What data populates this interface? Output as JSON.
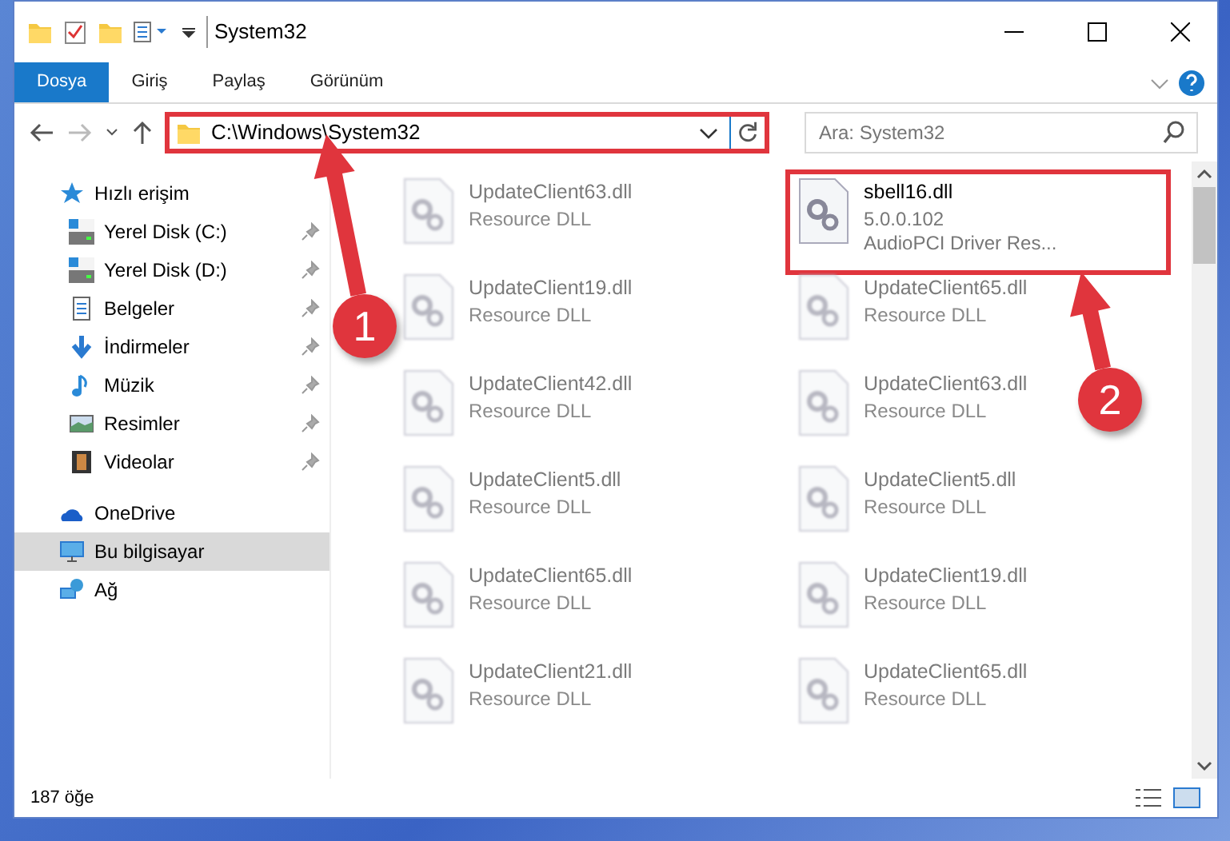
{
  "window": {
    "title": "System32"
  },
  "ribbon_tabs": [
    {
      "label": "Dosya",
      "selected": true
    },
    {
      "label": "Giriş",
      "selected": false
    },
    {
      "label": "Paylaş",
      "selected": false
    },
    {
      "label": "Görünüm",
      "selected": false
    }
  ],
  "address_bar": {
    "path": "C:\\Windows\\System32",
    "highlighted": true
  },
  "search": {
    "placeholder": "Ara: System32"
  },
  "sidebar": {
    "items": [
      {
        "label": "Hızlı erişim",
        "kind": "quick",
        "selected": false,
        "pinned": false,
        "children": [
          {
            "label": "Yerel Disk (C:)",
            "kind": "drive",
            "selected": false,
            "pinned": true
          },
          {
            "label": "Yerel Disk (D:)",
            "kind": "drive",
            "selected": false,
            "pinned": true
          },
          {
            "label": "Belgeler",
            "kind": "docs",
            "selected": false,
            "pinned": true
          },
          {
            "label": "İndirmeler",
            "kind": "download",
            "selected": false,
            "pinned": true
          },
          {
            "label": "Müzik",
            "kind": "music",
            "selected": false,
            "pinned": true
          },
          {
            "label": "Resimler",
            "kind": "pictures",
            "selected": false,
            "pinned": true
          },
          {
            "label": "Videolar",
            "kind": "videos",
            "selected": false,
            "pinned": true
          }
        ]
      },
      {
        "label": "OneDrive",
        "kind": "cloud",
        "selected": false,
        "pinned": false
      },
      {
        "label": "Bu bilgisayar",
        "kind": "pc",
        "selected": true,
        "pinned": false
      },
      {
        "label": "Ağ",
        "kind": "network",
        "selected": false,
        "pinned": false
      }
    ]
  },
  "files": [
    {
      "name": "UpdateClient63.dll",
      "lines": [
        "Resource DLL"
      ],
      "blurred": true,
      "highlighted": false
    },
    {
      "name": "sbell16.dll",
      "lines": [
        "5.0.0.102",
        "AudioPCI Driver Res..."
      ],
      "blurred": false,
      "highlighted": true
    },
    {
      "name": "UpdateClient19.dll",
      "lines": [
        "Resource DLL"
      ],
      "blurred": true,
      "highlighted": false
    },
    {
      "name": "UpdateClient65.dll",
      "lines": [
        "Resource DLL"
      ],
      "blurred": true,
      "highlighted": false
    },
    {
      "name": "UpdateClient42.dll",
      "lines": [
        "Resource DLL"
      ],
      "blurred": true,
      "highlighted": false
    },
    {
      "name": "UpdateClient63.dll",
      "lines": [
        "Resource DLL"
      ],
      "blurred": true,
      "highlighted": false
    },
    {
      "name": "UpdateClient5.dll",
      "lines": [
        "Resource DLL"
      ],
      "blurred": true,
      "highlighted": false
    },
    {
      "name": "UpdateClient5.dll",
      "lines": [
        "Resource DLL"
      ],
      "blurred": true,
      "highlighted": false
    },
    {
      "name": "UpdateClient65.dll",
      "lines": [
        "Resource DLL"
      ],
      "blurred": true,
      "highlighted": false
    },
    {
      "name": "UpdateClient19.dll",
      "lines": [
        "Resource DLL"
      ],
      "blurred": true,
      "highlighted": false
    },
    {
      "name": "UpdateClient21.dll",
      "lines": [
        "Resource DLL"
      ],
      "blurred": true,
      "highlighted": false
    },
    {
      "name": "UpdateClient65.dll",
      "lines": [
        "Resource DLL"
      ],
      "blurred": true,
      "highlighted": false
    }
  ],
  "status_bar": {
    "count": "187 öğe"
  },
  "annotations": [
    {
      "number": "1"
    },
    {
      "number": "2"
    }
  ]
}
